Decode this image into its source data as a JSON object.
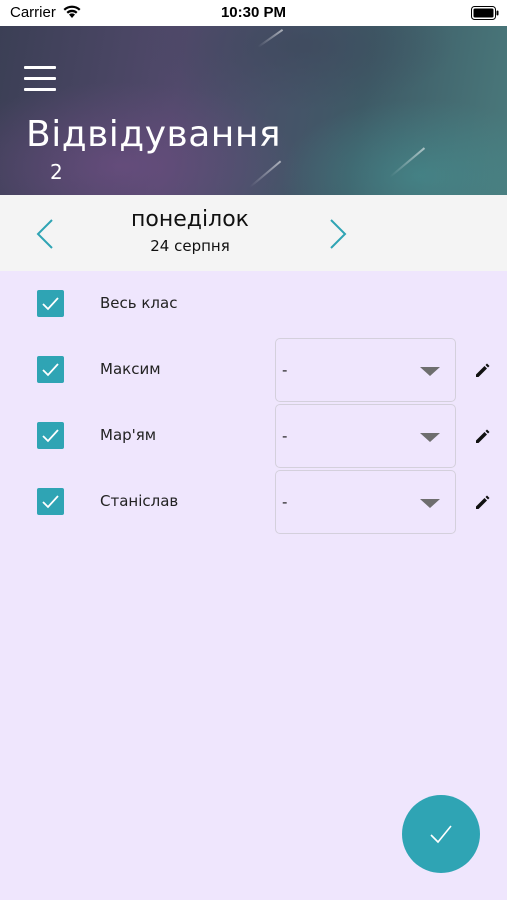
{
  "status_bar": {
    "carrier": "Carrier",
    "time": "10:30 PM"
  },
  "header": {
    "title": "Відвідування",
    "subtitle": "2"
  },
  "date_nav": {
    "day_name": "понеділок",
    "date": "24 серпня"
  },
  "colors": {
    "accent": "#2fa4b4",
    "background": "#efe6fd"
  },
  "select_all": {
    "label": "Весь клас",
    "checked": true
  },
  "students": [
    {
      "name": "Максим",
      "checked": true,
      "status": "-"
    },
    {
      "name": "Мар'ям",
      "checked": true,
      "status": "-"
    },
    {
      "name": "Станіслав",
      "checked": true,
      "status": "-"
    }
  ]
}
